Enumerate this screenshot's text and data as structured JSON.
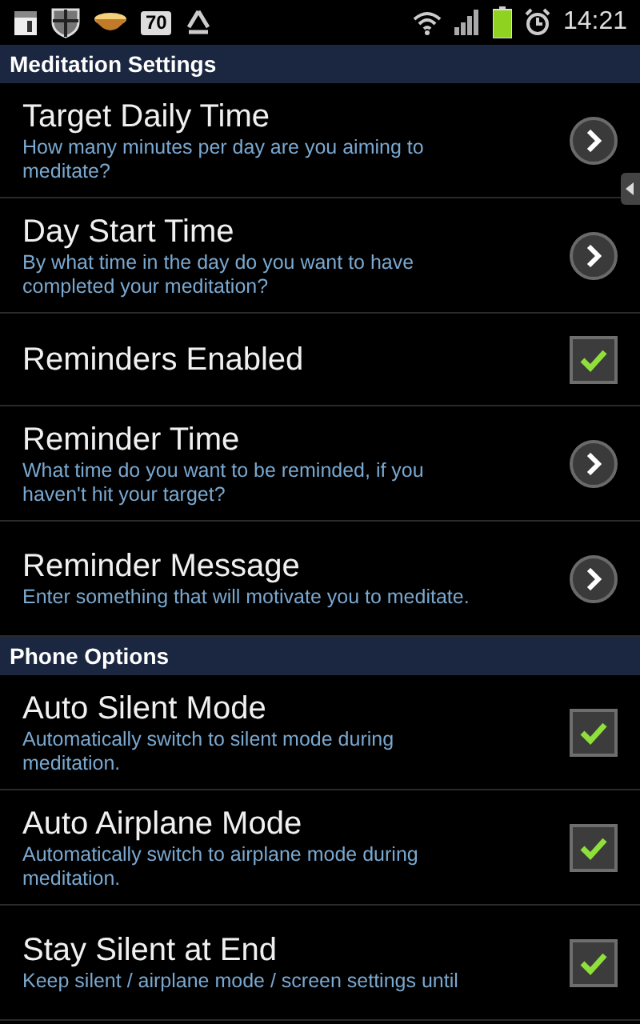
{
  "status_bar": {
    "badge": "70",
    "time": "14:21"
  },
  "sections": [
    {
      "title": "Meditation Settings",
      "items": [
        {
          "kind": "arrow",
          "title": "Target Daily Time",
          "summary": "How many minutes per day are you aiming to meditate?"
        },
        {
          "kind": "arrow",
          "title": "Day Start Time",
          "summary": "By what time in the day do you want to have completed your meditation?"
        },
        {
          "kind": "checkbox",
          "title": "Reminders Enabled",
          "checked": true
        },
        {
          "kind": "arrow",
          "title": "Reminder Time",
          "summary": "What time do you want to be reminded, if you haven't hit your target?"
        },
        {
          "kind": "arrow",
          "title": "Reminder Message",
          "summary": "Enter something that will motivate you to meditate."
        }
      ]
    },
    {
      "title": "Phone Options",
      "items": [
        {
          "kind": "checkbox",
          "title": "Auto Silent Mode",
          "summary": "Automatically switch to silent mode during meditation.",
          "checked": true
        },
        {
          "kind": "checkbox",
          "title": "Auto Airplane Mode",
          "summary": "Automatically switch to airplane mode during meditation.",
          "checked": true
        },
        {
          "kind": "checkbox",
          "title": "Stay Silent at End",
          "summary": "Keep silent / airplane mode / screen settings until",
          "checked": true
        }
      ]
    }
  ]
}
